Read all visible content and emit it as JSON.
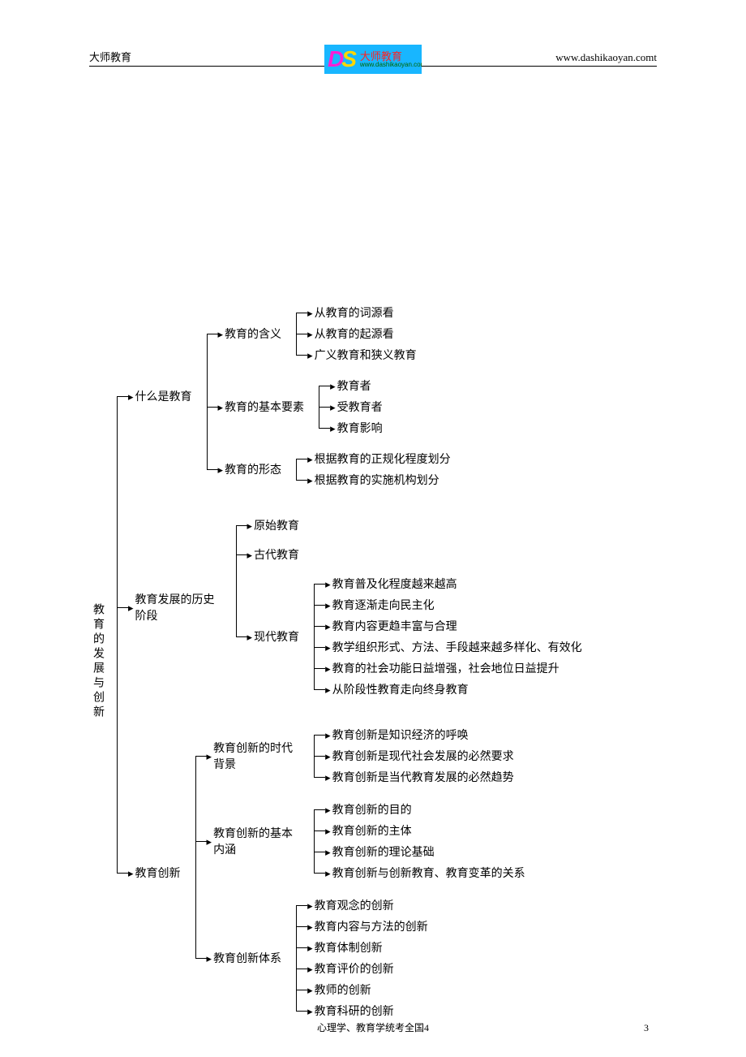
{
  "header": {
    "left": "大师教育",
    "right": "www.dashikaoyan.comt",
    "logo_cn": "大师教育",
    "logo_url": "www.dashikaoyan.com"
  },
  "footer": {
    "text": "心理学、教育学统考全国4",
    "pagenum": "3"
  },
  "root": "教育的发展与创新",
  "b1": {
    "label": "什么是教育",
    "n1": {
      "label": "教育的含义",
      "items": [
        "从教育的词源看",
        "从教育的起源看",
        "广义教育和狭义教育"
      ]
    },
    "n2": {
      "label": "教育的基本要素",
      "items": [
        "教育者",
        "受教育者",
        "教育影响"
      ]
    },
    "n3": {
      "label": "教育的形态",
      "items": [
        "根据教育的正规化程度划分",
        "根据教育的实施机构划分"
      ]
    }
  },
  "b2": {
    "label": "教育发展的历史阶段",
    "n1": {
      "label": "原始教育"
    },
    "n2": {
      "label": "古代教育"
    },
    "n3": {
      "label": "现代教育",
      "items": [
        "教育普及化程度越来越高",
        "教育逐渐走向民主化",
        "教育内容更趋丰富与合理",
        "教学组织形式、方法、手段越来越多样化、有效化",
        "教育的社会功能日益增强，社会地位日益提升",
        "从阶段性教育走向终身教育"
      ]
    }
  },
  "b3": {
    "label": "教育创新",
    "n1": {
      "label": "教育创新的时代背景",
      "items": [
        "教育创新是知识经济的呼唤",
        "教育创新是现代社会发展的必然要求",
        "教育创新是当代教育发展的必然趋势"
      ]
    },
    "n2": {
      "label": "教育创新的基本内涵",
      "items": [
        "教育创新的目的",
        "教育创新的主体",
        "教育创新的理论基础",
        "教育创新与创新教育、教育变革的关系"
      ]
    },
    "n3": {
      "label": "教育创新体系",
      "items": [
        "教育观念的创新",
        "教育内容与方法的创新",
        "教育体制创新",
        "教育评价的创新",
        "教师的创新",
        "教育科研的创新"
      ]
    }
  }
}
